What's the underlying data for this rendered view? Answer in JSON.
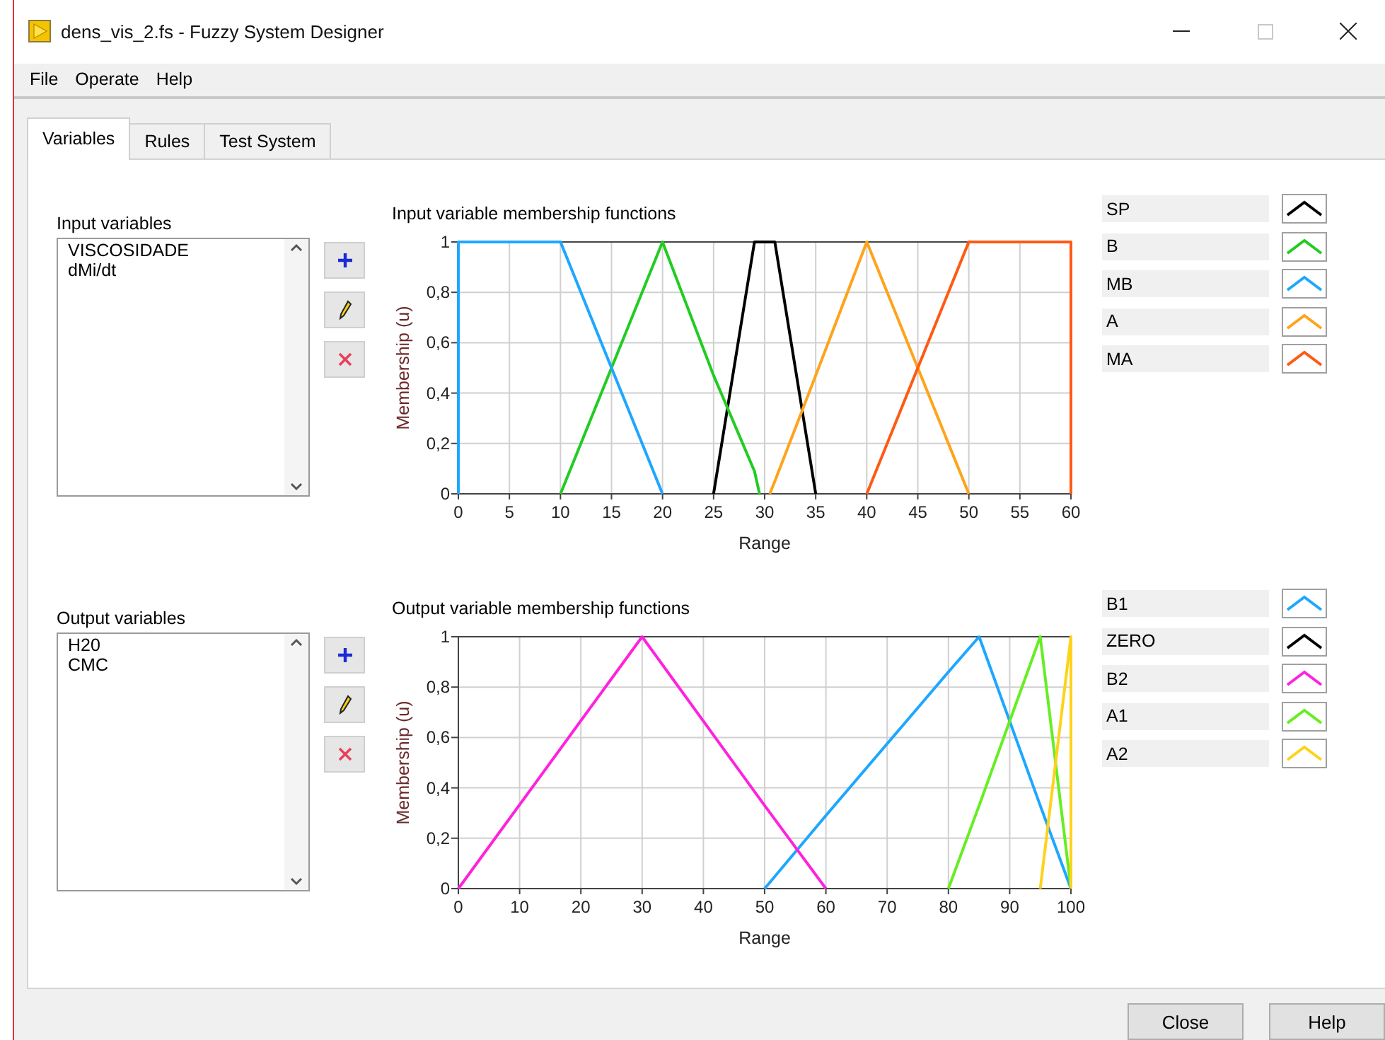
{
  "window": {
    "title": "dens_vis_2.fs - Fuzzy System Designer"
  },
  "menu": [
    "File",
    "Operate",
    "Help"
  ],
  "tabs": [
    {
      "label": "Variables",
      "selected": true
    },
    {
      "label": "Rules",
      "selected": false
    },
    {
      "label": "Test System",
      "selected": false
    }
  ],
  "input_variables": {
    "label": "Input variables",
    "items": [
      "VISCOSIDADE",
      "dMi/dt"
    ]
  },
  "input_chart": {
    "chart_data": {
      "type": "line",
      "grid": true,
      "title": "Input variable membership functions",
      "xlabel": "Range",
      "ylabel": "Membership (u)",
      "x": [
        0,
        0,
        10,
        20,
        25,
        29,
        29.5,
        30.5,
        31,
        35,
        40,
        50,
        60,
        60
      ],
      "xlim": [
        0,
        60
      ],
      "ylim": [
        0,
        1
      ],
      "xticks": [
        0,
        5,
        10,
        15,
        20,
        25,
        30,
        35,
        40,
        45,
        50,
        55,
        60
      ],
      "yticks": [
        0,
        {
          "value": 0.2,
          "label": "0,2"
        },
        {
          "value": 0.4,
          "label": "0,4"
        },
        {
          "value": 0.6,
          "label": "0,6"
        },
        {
          "value": 0.8,
          "label": "0,8"
        },
        1
      ],
      "series": [
        {
          "name": "SP",
          "color": "#000000",
          "values": [
            null,
            null,
            null,
            null,
            0,
            1,
            1,
            1,
            1,
            0,
            null,
            null,
            null,
            null
          ]
        },
        {
          "name": "B",
          "color": "#22cc22",
          "values": [
            null,
            null,
            0,
            1,
            0.47,
            0.09,
            0,
            null,
            null,
            null,
            null,
            null,
            null,
            null
          ]
        },
        {
          "name": "MB",
          "color": "#1ea7ff",
          "values": [
            0,
            1,
            1,
            0,
            null,
            null,
            null,
            null,
            null,
            null,
            null,
            null,
            null,
            null
          ]
        },
        {
          "name": "A",
          "color": "#ffa31a",
          "values": [
            null,
            null,
            null,
            null,
            null,
            null,
            null,
            0,
            0.05,
            0.47,
            1,
            0,
            null,
            null
          ]
        },
        {
          "name": "MA",
          "color": "#ff5a14",
          "values": [
            null,
            null,
            null,
            null,
            null,
            null,
            null,
            null,
            null,
            null,
            0,
            1,
            1,
            0
          ]
        }
      ]
    }
  },
  "output_variables": {
    "label": "Output variables",
    "items": [
      "H20",
      "CMC"
    ]
  },
  "output_chart": {
    "chart_data": {
      "type": "line",
      "grid": true,
      "title": "Output variable membership functions",
      "xlabel": "Range",
      "ylabel": "Membership (u)",
      "x": [
        0,
        30,
        50,
        60,
        80,
        85,
        95,
        100,
        100
      ],
      "xlim": [
        0,
        100
      ],
      "ylim": [
        0,
        1
      ],
      "xticks": [
        0,
        10,
        20,
        30,
        40,
        50,
        60,
        70,
        80,
        90,
        100
      ],
      "yticks": [
        0,
        {
          "value": 0.2,
          "label": "0,2"
        },
        {
          "value": 0.4,
          "label": "0,4"
        },
        {
          "value": 0.6,
          "label": "0,6"
        },
        {
          "value": 0.8,
          "label": "0,8"
        },
        1
      ],
      "series": [
        {
          "name": "B1",
          "color": "#1ea7ff",
          "values": [
            null,
            null,
            0,
            0.29,
            0.86,
            1,
            0.33,
            0,
            null
          ]
        },
        {
          "name": "ZERO",
          "color": "#000000",
          "values": [
            null,
            null,
            null,
            null,
            null,
            null,
            null,
            null,
            null
          ]
        },
        {
          "name": "B2",
          "color": "#ff22dd",
          "values": [
            0,
            1,
            0.33,
            0,
            null,
            null,
            null,
            null,
            null
          ]
        },
        {
          "name": "A1",
          "color": "#66ee22",
          "values": [
            null,
            null,
            null,
            null,
            0,
            0.33,
            1,
            0,
            null
          ]
        },
        {
          "name": "A2",
          "color": "#ffd21a",
          "values": [
            null,
            null,
            null,
            null,
            null,
            null,
            0,
            1,
            0
          ]
        }
      ]
    }
  },
  "buttons": [
    "Close",
    "Help"
  ]
}
